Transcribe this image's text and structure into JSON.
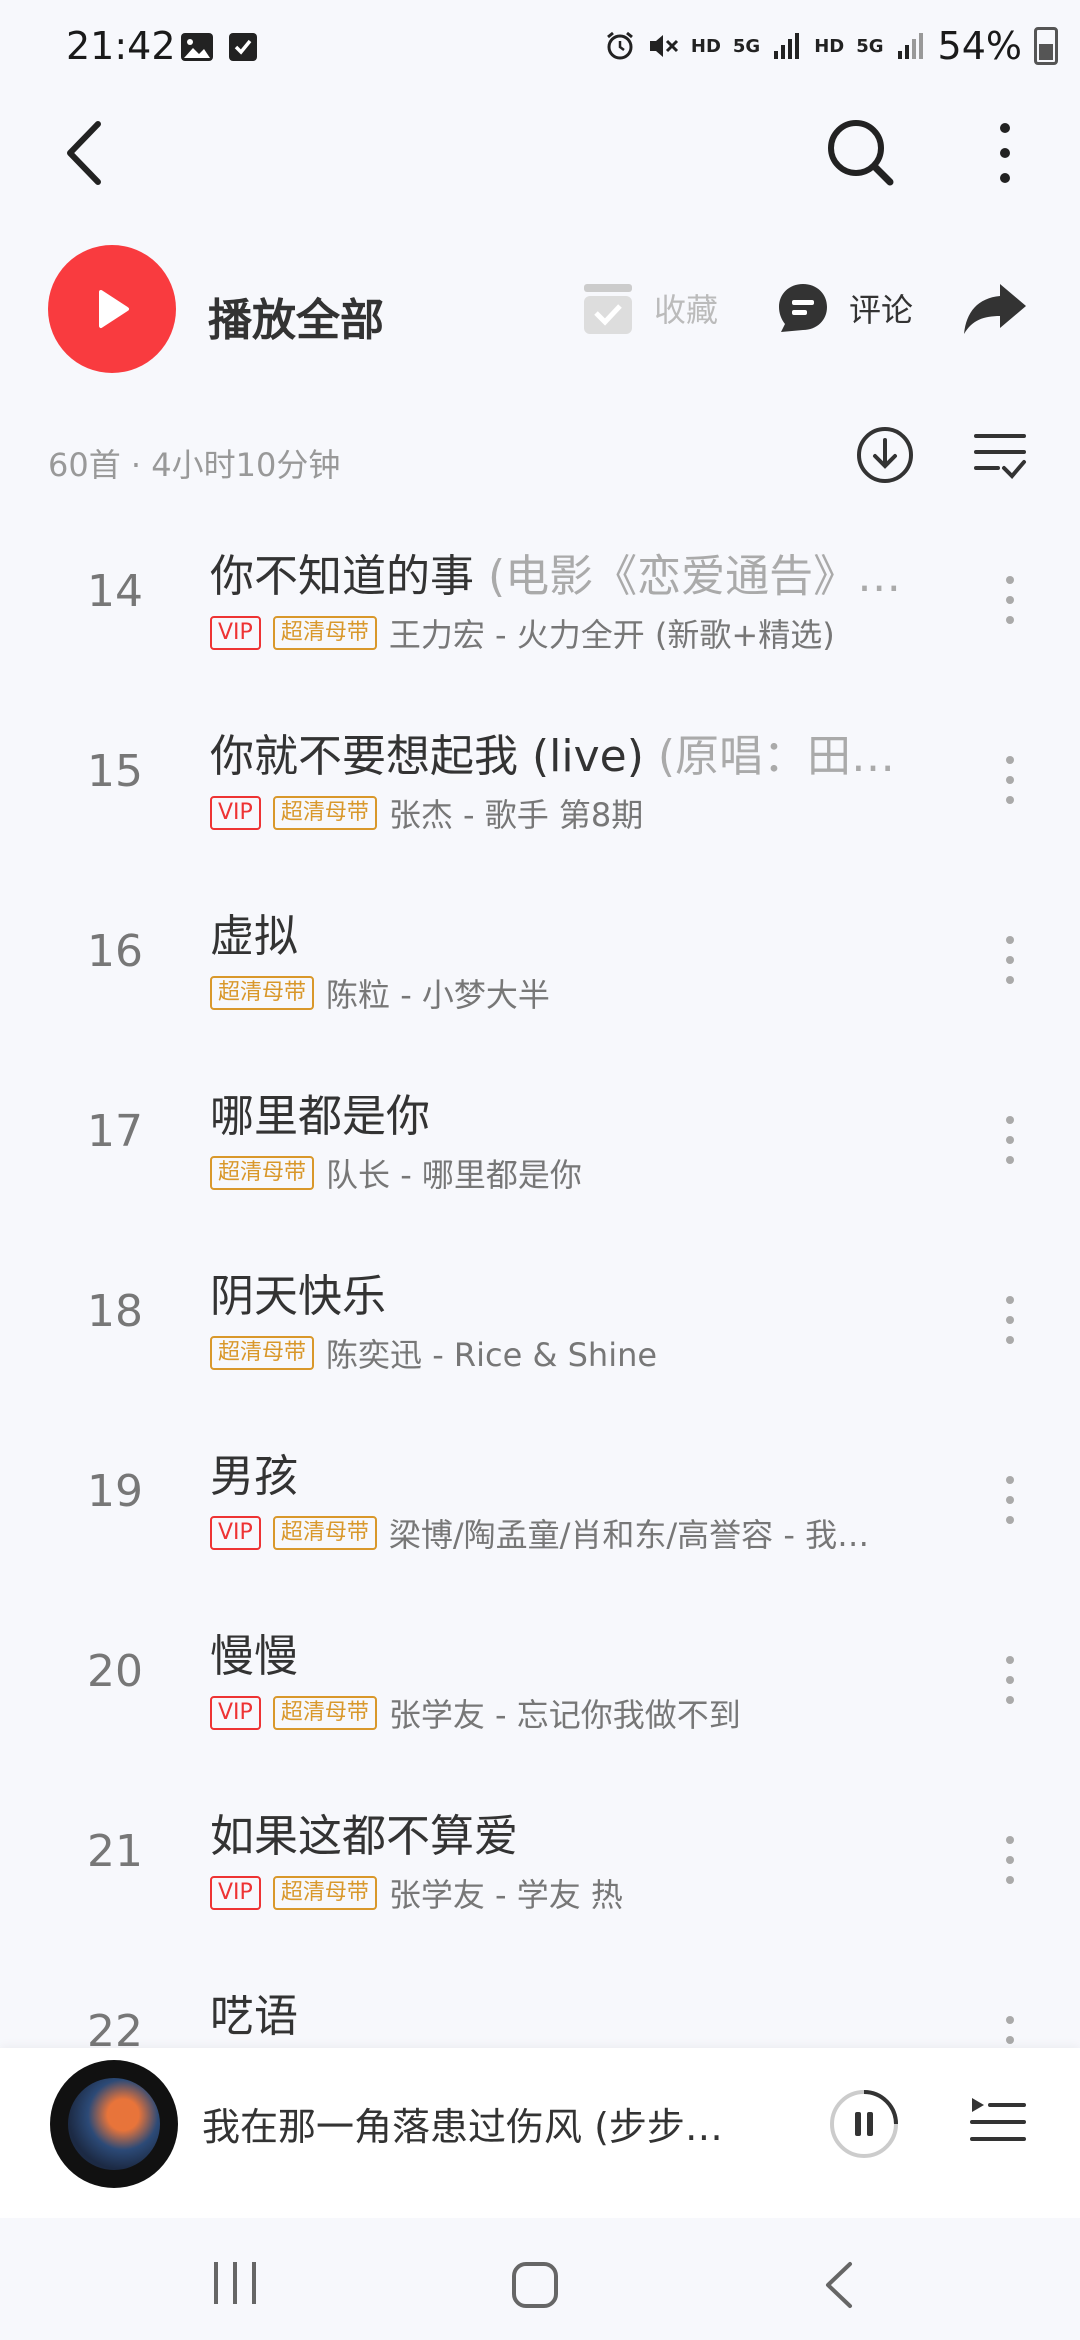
{
  "status_bar": {
    "time": "21:42",
    "hd1": "HD",
    "net1": "5G",
    "hd2": "HD",
    "net2": "5G",
    "battery": "54%"
  },
  "header": {
    "icons": [
      "back-icon",
      "search-icon",
      "more-vertical-icon"
    ]
  },
  "actions": {
    "play_all": "播放全部",
    "collect": "收藏",
    "comment": "评论"
  },
  "summary": {
    "count_duration": "60首 · 4小时10分钟"
  },
  "colors": {
    "accent_red": "#f93b3f",
    "vip_red": "#e33333",
    "hq_gold": "#d9982b"
  },
  "badges": {
    "vip": "VIP",
    "hq": "超清母带"
  },
  "tracks": [
    {
      "num": "14",
      "title": "你不知道的事",
      "subtitle": "(电影《恋爱通告》…",
      "vip": true,
      "hq": true,
      "artist": "王力宏 - 火力全开 (新歌+精选)"
    },
    {
      "num": "15",
      "title": "你就不要想起我 (live)",
      "subtitle": "(原唱：田…",
      "vip": true,
      "hq": true,
      "artist": "张杰 - 歌手 第8期"
    },
    {
      "num": "16",
      "title": "虚拟",
      "subtitle": "",
      "vip": false,
      "hq": true,
      "artist": "陈粒 - 小梦大半"
    },
    {
      "num": "17",
      "title": "哪里都是你",
      "subtitle": "",
      "vip": false,
      "hq": true,
      "artist": "队长 - 哪里都是你"
    },
    {
      "num": "18",
      "title": "阴天快乐",
      "subtitle": "",
      "vip": false,
      "hq": true,
      "artist": "陈奕迅 - Rice & Shine"
    },
    {
      "num": "19",
      "title": "男孩",
      "subtitle": "",
      "vip": true,
      "hq": true,
      "artist": "梁博/陶孟童/肖和东/高誉容 - 我…"
    },
    {
      "num": "20",
      "title": "慢慢",
      "subtitle": "",
      "vip": true,
      "hq": true,
      "artist": "张学友 - 忘记你我做不到"
    },
    {
      "num": "21",
      "title": "如果这都不算爱",
      "subtitle": "",
      "vip": true,
      "hq": true,
      "artist": "张学友 - 学友 热"
    },
    {
      "num": "22",
      "title": "呓语",
      "subtitle": "",
      "vip": false,
      "hq": false,
      "artist": ""
    }
  ],
  "mini_player": {
    "title": "我在那一角落患过伤风 (步步…"
  }
}
